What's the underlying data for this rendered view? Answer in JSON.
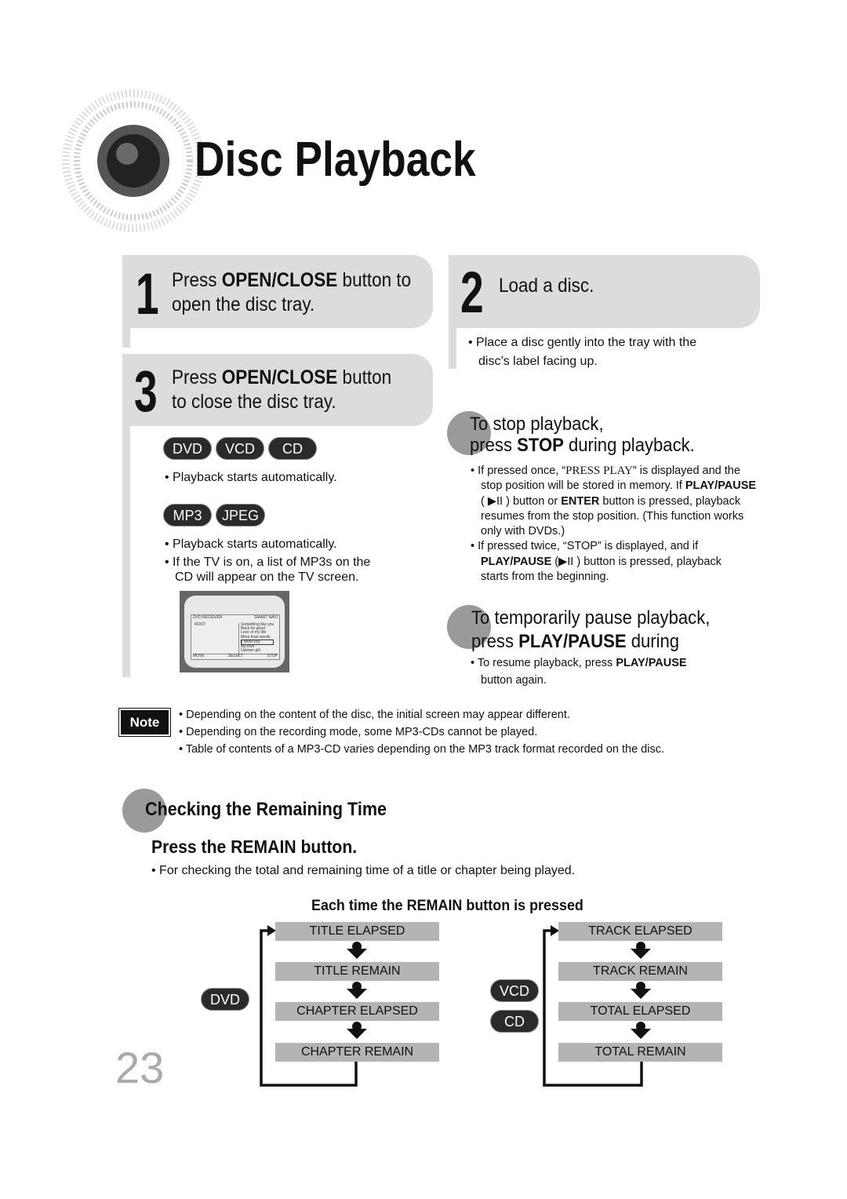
{
  "page": {
    "title": "Disc Playback",
    "page_number": "23"
  },
  "step1": {
    "number": "1",
    "pre": "Press ",
    "bold": "OPEN/CLOSE",
    "post": " button to",
    "line2": "open the disc tray."
  },
  "step2": {
    "number": "2",
    "text": "Load a disc.",
    "bullet": "Place a disc gently into the tray with the",
    "bullet2": "disc’s label facing up."
  },
  "step3": {
    "number": "3",
    "pre": "Press ",
    "bold": "OPEN/CLOSE",
    "post": " button",
    "line2": "to close the disc tray."
  },
  "badges1": [
    "DVD",
    "VCD",
    "CD"
  ],
  "badges1_note": "Playback starts automatically.",
  "badges2": [
    "MP3",
    "JPEG"
  ],
  "badges2_notes": [
    "Playback starts automatically.",
    "If the TV is on, a list of MP3s on the",
    "CD will appear on the TV screen."
  ],
  "tv_screen": {
    "header_left": "DVD RECEIVER",
    "header_right": "SMART NAVI",
    "root": "ROOT",
    "tracks": [
      "Something like you",
      "Back for good",
      "Love of my life",
      "More than words",
      "I need you",
      "My love",
      "Uptown girl"
    ],
    "footer": [
      "MOVE",
      "SELECT",
      "STOP"
    ]
  },
  "stop": {
    "line1": "To stop playback,",
    "line2_pre": "press ",
    "line2_bold": "STOP",
    "line2_post": " during playback.",
    "bullets": [
      [
        "If pressed once, “",
        "PRESS PLAY",
        "” is displayed and the"
      ],
      [
        "stop position will be stored in memory. If ",
        "PLAY/PAUSE",
        ""
      ],
      [
        "( ▶II ) button or ",
        "ENTER",
        " button is pressed, playback"
      ],
      [
        "resumes from the stop position. (This function works",
        "",
        ""
      ],
      [
        "only with DVDs.)",
        "",
        ""
      ],
      [
        "If pressed twice, “STOP” is displayed, and if",
        "",
        ""
      ],
      [
        "",
        "PLAY/PAUSE",
        " (▶II  ) button is pressed, playback"
      ],
      [
        "starts from the beginning.",
        "",
        ""
      ]
    ]
  },
  "pause": {
    "line1": "To temporarily pause playback,",
    "line2_pre": "press ",
    "line2_bold": "PLAY/PAUSE",
    "line2_post": " during",
    "bullet_pre": "To resume playback, press ",
    "bullet_bold": "PLAY/PAUSE",
    "bullet2": "button again."
  },
  "note": {
    "label": "Note",
    "items": [
      "Depending on the content of the disc, the initial screen may appear different.",
      "Depending on the recording mode, some MP3-CDs cannot be played.",
      "Table of contents of a MP3-CD varies depending on the MP3 track format recorded on the disc."
    ]
  },
  "remaining": {
    "title": "Checking the Remaining Time",
    "subtitle": "Press the REMAIN button.",
    "bullet": "For checking the total and remaining time of a title or chapter being played.",
    "diagram_title": "Each time the REMAIN button is pressed",
    "dvd_label": "DVD",
    "dvd_steps": [
      "TITLE ELAPSED",
      "TITLE REMAIN",
      "CHAPTER ELAPSED",
      "CHAPTER REMAIN"
    ],
    "vcd_label": "VCD",
    "cd_label": "CD",
    "cd_steps": [
      "TRACK ELAPSED",
      "TRACK REMAIN",
      "TOTAL ELAPSED",
      "TOTAL REMAIN"
    ]
  }
}
